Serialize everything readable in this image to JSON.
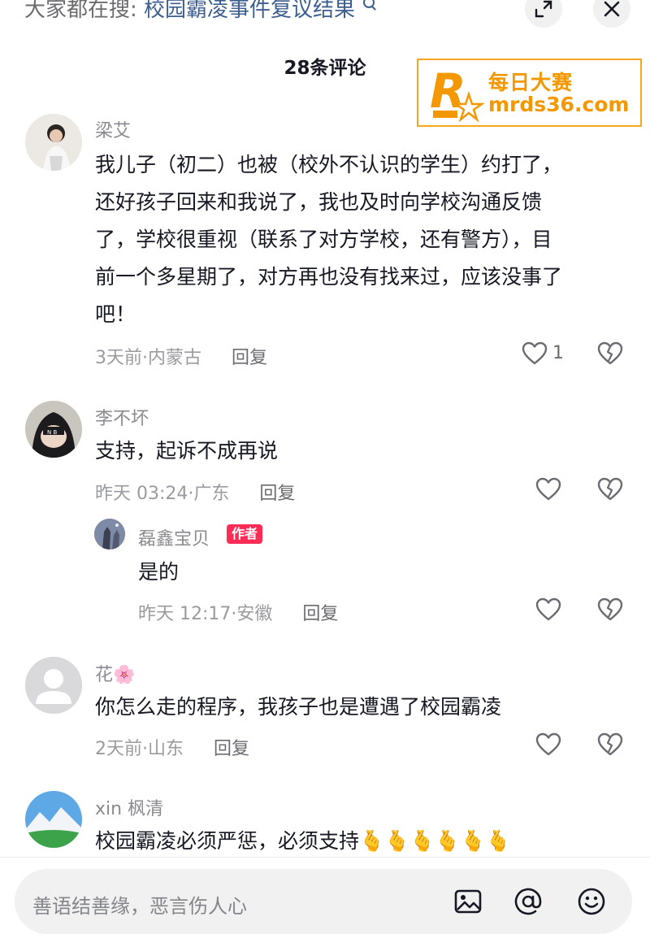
{
  "header": {
    "search_prefix": "大家都在搜:",
    "search_query": "校园霸凌事件复议结果",
    "comment_count_title": "28条评论"
  },
  "watermark": {
    "logo_letter": "R",
    "name": "每日大赛",
    "site": "mrds36.com"
  },
  "comments": [
    {
      "user": "梁艾",
      "text_lines": [
        "我儿子（初二）也被（校外不认识的学生）约打了，",
        "还好孩子回来和我说了，我也及时向学校沟通反馈",
        "了，学校很重视（联系了对方学校，还有警方），目",
        "前一个多星期了，对方再也没有找来过，应该没事了",
        "吧！"
      ],
      "time": "3天前",
      "location": "内蒙古",
      "reply_label": "回复",
      "likes": "1"
    },
    {
      "user": "李不坏",
      "text_lines": [
        "支持，起诉不成再说"
      ],
      "time": "昨天 03:24",
      "location": "广东",
      "reply_label": "回复",
      "replies": [
        {
          "user": "磊鑫宝贝",
          "tag": "作者",
          "text": "是的",
          "time": "昨天 12:17",
          "location": "安徽",
          "reply_label": "回复"
        }
      ]
    },
    {
      "user": "花🌸",
      "text_lines": [
        "你怎么走的程序，我孩子也是遭遇了校园霸凌"
      ],
      "time": "2天前",
      "location": "山东",
      "reply_label": "回复"
    },
    {
      "user": "xin 枫清",
      "text_lines": [
        "校园霸凌必须严惩，必须支持🫰🫰🫰🫰🫰🫰"
      ]
    }
  ],
  "bottom": {
    "placeholder": "善语结善缘，恶言伤人心"
  },
  "icons": [
    "search-icon",
    "expand-icon",
    "close-icon",
    "heart-icon",
    "dislike-icon",
    "image-icon",
    "at-icon",
    "emoji-icon"
  ],
  "colors": {
    "author_tag": "#fe2c55",
    "watermark": "#f39800",
    "link": "#3d5f8f"
  }
}
